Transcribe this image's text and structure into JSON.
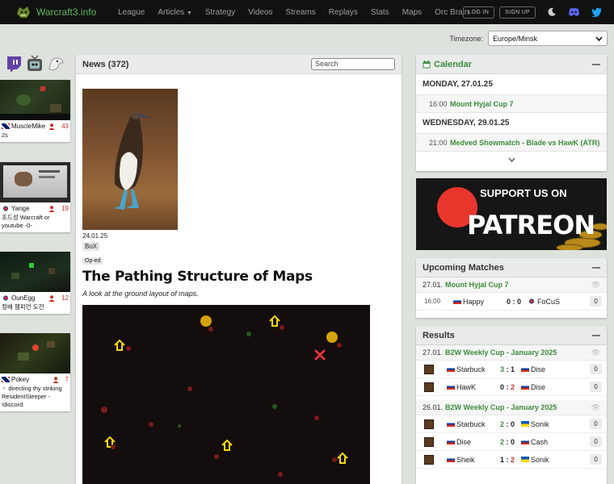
{
  "brand": {
    "name": "Warcraft3.info"
  },
  "nav": {
    "items": [
      "League",
      "Articles",
      "Strategy",
      "Videos",
      "Streams",
      "Replays",
      "Stats",
      "Maps",
      "Orc Brain"
    ],
    "login": "LOG IN",
    "signup": "SIGN UP"
  },
  "timezone": {
    "label": "Timezone:",
    "value": "Europe/Minsk"
  },
  "streams": [
    {
      "name": "MuscleMike",
      "viewers": "43",
      "title": "2s",
      "flag": "gb"
    },
    {
      "name": "Yange",
      "viewers": "19",
      "title": "조드성 Warcraft or youtube -0-",
      "flag": "kr"
    },
    {
      "name": "OunEgg",
      "viewers": "12",
      "title": "정배 챔피언 도전",
      "flag": "kr"
    },
    {
      "name": "Pokey",
      "viewers": "7",
      "title": "directing thy striking ResidentSleeper - !discord",
      "flag": "gb"
    }
  ],
  "news": {
    "header": "News (372)",
    "search_placeholder": "Search",
    "date": "24.01.25",
    "author": "BoX",
    "category": "Op-ed",
    "title": "The Pathing Structure of Maps",
    "subtitle": "A look at the ground layout of maps."
  },
  "calendar": {
    "title": "Calendar",
    "days": [
      {
        "day": "MONDAY, 27.01.25",
        "events": [
          {
            "time": "16:00",
            "name": "Mount Hyjal Cup 7"
          }
        ]
      },
      {
        "day": "WEDNESDAY, 29.01.25",
        "events": [
          {
            "time": "21:00",
            "name": "Medved Showmatch - Blade vs HawK (ATR)"
          }
        ]
      }
    ]
  },
  "patreon": {
    "line1": "SUPPORT US ON",
    "line2": "PATREON"
  },
  "upcoming": {
    "title": "Upcoming Matches",
    "events": [
      {
        "date": "27.01.",
        "name": "Mount Hyjal Cup 7",
        "matches": [
          {
            "time": "16:00",
            "p1": "Happy",
            "score": "0 : 0",
            "p2": "FoCuS",
            "comments": "0"
          }
        ]
      }
    ]
  },
  "results": {
    "title": "Results",
    "events": [
      {
        "date": "27.01.",
        "name": "B2W Weekly Cup - January 2025",
        "matches": [
          {
            "p1": "Starbuck",
            "s1": "3",
            "s2": "1",
            "p2": "Dise",
            "comments": "0"
          },
          {
            "p1": "HawK",
            "s1": "0",
            "s2": "2",
            "p2": "Dise",
            "comments": "0"
          }
        ]
      },
      {
        "date": "26.01.",
        "name": "B2W Weekly Cup - January 2025",
        "matches": [
          {
            "p1": "Starbuck",
            "s1": "2",
            "s2": "0",
            "p2": "Sonik",
            "comments": "0"
          },
          {
            "p1": "Dise",
            "s1": "2",
            "s2": "0",
            "p2": "Cash",
            "comments": "0"
          },
          {
            "p1": "Sheik",
            "s1": "1",
            "s2": "2",
            "p2": "Sonik",
            "comments": "0"
          }
        ]
      }
    ]
  },
  "colors": {
    "accent": "#3c8c3c",
    "danger": "#c9302c",
    "navbar": "#111111",
    "background": "#dde3dc"
  }
}
